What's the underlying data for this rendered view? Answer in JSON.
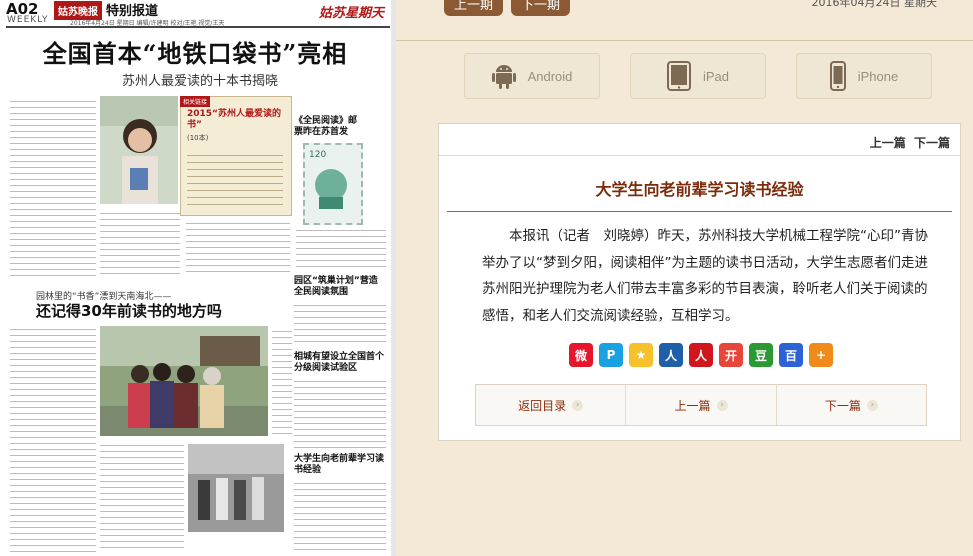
{
  "newspaper": {
    "page_no": "A02",
    "weekly": "WEEKLY",
    "logo": "姑苏晚报",
    "section": "特别报道",
    "date_line": "2016年4月24日 星期日 编辑/许建明 校对/王艳 视觉/王天",
    "brand": "姑苏星期天",
    "headline": "全国首本“地铁口袋书”亮相",
    "subheadline": "苏州人最爱读的十本书揭晓",
    "box_tag": "相关链接",
    "box_title": "2015“苏州人最爱读的书”",
    "box_count": "(10本)",
    "side_title": "《全民阅读》邮票昨在苏首发",
    "section2_sub": "园林里的“书香”漂到天南海北——",
    "section2_title": "还记得30年前读书的地方吗",
    "col_title_1": "园区“筑巢计划”营造全民阅读氛围",
    "col_title_2": "相城有望设立全国首个分级阅读试验区",
    "col_title_3": "大学生向老前辈学习读书经验",
    "stamp_value": "120"
  },
  "toolbar": {
    "prev_issue": "上一期",
    "next_issue": "下一期",
    "date": "2016年04月24日 星期天"
  },
  "devices": [
    {
      "label": "Android",
      "icon": "android-icon"
    },
    {
      "label": "iPad",
      "icon": "ipad-icon"
    },
    {
      "label": "iPhone",
      "icon": "iphone-icon"
    }
  ],
  "article": {
    "nav_prev": "上一篇",
    "nav_next": "下一篇",
    "title": "大学生向老前辈学习读书经验",
    "body": "本报讯（记者　刘晓婷）昨天，苏州科技大学机械工程学院“心印”青协举办了以“梦到夕阳，阅读相伴”为主题的读书日活动，大学生志愿者们走进苏州阳光护理院为老人们带去丰富多彩的节目表演，聆听老人们关于阅读的感悟，和老人们交流阅读经验，互相学习。"
  },
  "share_icons": [
    {
      "name": "weibo-share-icon",
      "color": "#e6162d",
      "glyph": "微"
    },
    {
      "name": "tencent-weibo-share-icon",
      "color": "#1aa1e1",
      "glyph": "P"
    },
    {
      "name": "qzone-share-icon",
      "color": "#f7c12b",
      "glyph": "★"
    },
    {
      "name": "renren-share-icon",
      "color": "#1f5faa",
      "glyph": "人"
    },
    {
      "name": "people-share-icon",
      "color": "#d2161e",
      "glyph": "人"
    },
    {
      "name": "kaixin-share-icon",
      "color": "#e8463a",
      "glyph": "开"
    },
    {
      "name": "douban-share-icon",
      "color": "#2b9a35",
      "glyph": "豆"
    },
    {
      "name": "baidu-share-icon",
      "color": "#2d62d6",
      "glyph": "百"
    },
    {
      "name": "more-share-icon",
      "color": "#f08a1b",
      "glyph": "+"
    }
  ],
  "bottom_nav": {
    "back": "返回目录",
    "prev": "上一篇",
    "next": "下一篇"
  },
  "colors": {
    "accent_brown": "#8b5a35",
    "title_red": "#7a2c0b",
    "panel_bg": "#f3e9d6"
  }
}
